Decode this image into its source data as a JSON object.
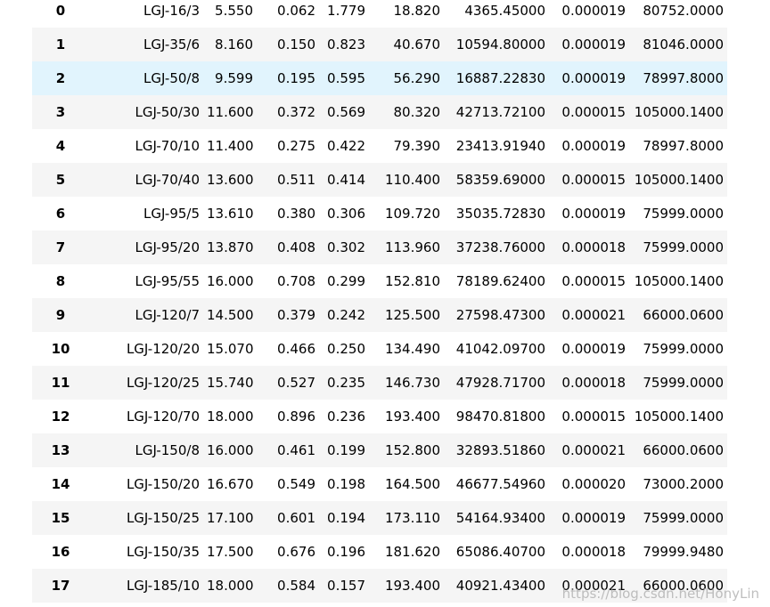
{
  "table": {
    "rows": [
      [
        "0",
        "LGJ-16/3",
        "5.550",
        "0.062",
        "1.779",
        "18.820",
        "4365.45000",
        "0.000019",
        "80752.0000"
      ],
      [
        "1",
        "LGJ-35/6",
        "8.160",
        "0.150",
        "0.823",
        "40.670",
        "10594.80000",
        "0.000019",
        "81046.0000"
      ],
      [
        "2",
        "LGJ-50/8",
        "9.599",
        "0.195",
        "0.595",
        "56.290",
        "16887.22830",
        "0.000019",
        "78997.8000"
      ],
      [
        "3",
        "LGJ-50/30",
        "11.600",
        "0.372",
        "0.569",
        "80.320",
        "42713.72100",
        "0.000015",
        "105000.1400"
      ],
      [
        "4",
        "LGJ-70/10",
        "11.400",
        "0.275",
        "0.422",
        "79.390",
        "23413.91940",
        "0.000019",
        "78997.8000"
      ],
      [
        "5",
        "LGJ-70/40",
        "13.600",
        "0.511",
        "0.414",
        "110.400",
        "58359.69000",
        "0.000015",
        "105000.1400"
      ],
      [
        "6",
        "LGJ-95/5",
        "13.610",
        "0.380",
        "0.306",
        "109.720",
        "35035.72830",
        "0.000019",
        "75999.0000"
      ],
      [
        "7",
        "LGJ-95/20",
        "13.870",
        "0.408",
        "0.302",
        "113.960",
        "37238.76000",
        "0.000018",
        "75999.0000"
      ],
      [
        "8",
        "LGJ-95/55",
        "16.000",
        "0.708",
        "0.299",
        "152.810",
        "78189.62400",
        "0.000015",
        "105000.1400"
      ],
      [
        "9",
        "LGJ-120/7",
        "14.500",
        "0.379",
        "0.242",
        "125.500",
        "27598.47300",
        "0.000021",
        "66000.0600"
      ],
      [
        "10",
        "LGJ-120/20",
        "15.070",
        "0.466",
        "0.250",
        "134.490",
        "41042.09700",
        "0.000019",
        "75999.0000"
      ],
      [
        "11",
        "LGJ-120/25",
        "15.740",
        "0.527",
        "0.235",
        "146.730",
        "47928.71700",
        "0.000018",
        "75999.0000"
      ],
      [
        "12",
        "LGJ-120/70",
        "18.000",
        "0.896",
        "0.236",
        "193.400",
        "98470.81800",
        "0.000015",
        "105000.1400"
      ],
      [
        "13",
        "LGJ-150/8",
        "16.000",
        "0.461",
        "0.199",
        "152.800",
        "32893.51860",
        "0.000021",
        "66000.0600"
      ],
      [
        "14",
        "LGJ-150/20",
        "16.670",
        "0.549",
        "0.198",
        "164.500",
        "46677.54960",
        "0.000020",
        "73000.2000"
      ],
      [
        "15",
        "LGJ-150/25",
        "17.100",
        "0.601",
        "0.194",
        "173.110",
        "54164.93400",
        "0.000019",
        "75999.0000"
      ],
      [
        "16",
        "LGJ-150/35",
        "17.500",
        "0.676",
        "0.196",
        "181.620",
        "65086.40700",
        "0.000018",
        "79999.9480"
      ],
      [
        "17",
        "LGJ-185/10",
        "18.000",
        "0.584",
        "0.157",
        "193.400",
        "40921.43400",
        "0.000021",
        "66000.0600"
      ]
    ],
    "hover_row_index": 2
  },
  "watermark": "https://blog.csdn.net/HonyLin"
}
